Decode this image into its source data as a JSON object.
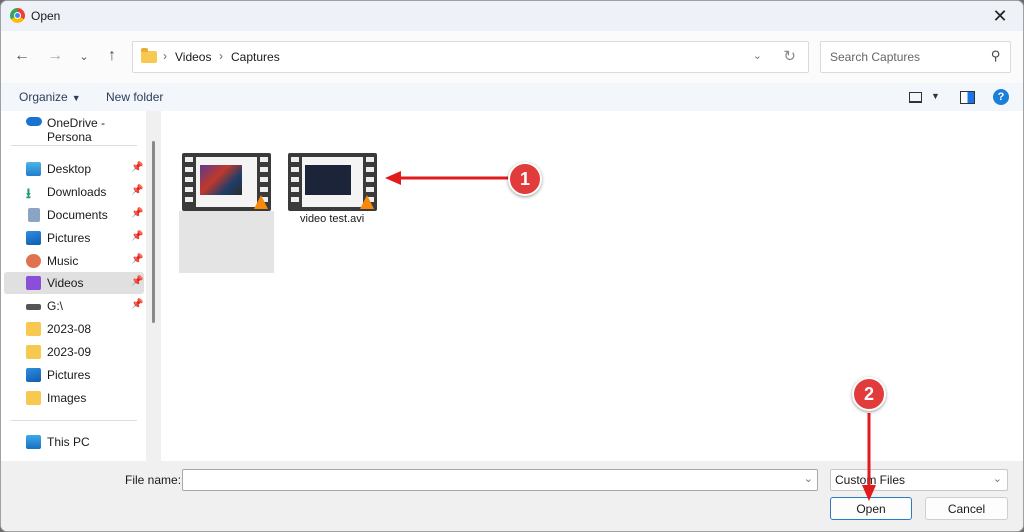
{
  "window": {
    "title": "Open",
    "app_icon": "chrome-icon",
    "close_icon": "close-icon"
  },
  "nav": {
    "back_icon": "arrow-left-icon",
    "forward_icon": "arrow-right-icon",
    "recent_icon": "chevron-down-icon",
    "up_icon": "arrow-up-icon",
    "breadcrumb": [
      "Videos",
      "Captures"
    ],
    "search_placeholder": "Search Captures"
  },
  "toolbar": {
    "organize_label": "Organize",
    "new_folder_label": "New folder"
  },
  "sidebar": {
    "onedrive": {
      "label": "OneDrive - Persona"
    },
    "quick_access": [
      {
        "label": "Desktop",
        "icon": "desktop-icon",
        "pinned": true
      },
      {
        "label": "Downloads",
        "icon": "download-icon",
        "pinned": true
      },
      {
        "label": "Documents",
        "icon": "document-icon",
        "pinned": true
      },
      {
        "label": "Pictures",
        "icon": "pictures-icon",
        "pinned": true
      },
      {
        "label": "Music",
        "icon": "music-icon",
        "pinned": true
      },
      {
        "label": "Videos",
        "icon": "videos-icon",
        "pinned": true,
        "selected": true
      },
      {
        "label": "G:\\",
        "icon": "drive-icon",
        "pinned": true
      },
      {
        "label": "2023-08",
        "icon": "folder-icon",
        "pinned": false
      },
      {
        "label": "2023-09",
        "icon": "folder-icon",
        "pinned": false
      },
      {
        "label": "Pictures",
        "icon": "pictures-icon",
        "pinned": false
      },
      {
        "label": "Images",
        "icon": "folder-icon",
        "pinned": false
      }
    ],
    "this_pc": {
      "label": "This PC"
    }
  },
  "files": [
    {
      "name": "",
      "type": "video-thumbnail"
    },
    {
      "name": "video test.avi",
      "type": "video-thumbnail"
    }
  ],
  "bottom": {
    "file_name_label": "File name:",
    "file_name_value": "",
    "file_type_value": "Custom Files",
    "open_label": "Open",
    "cancel_label": "Cancel"
  },
  "annotations": [
    {
      "number": "1",
      "color": "#e23b3b"
    },
    {
      "number": "2",
      "color": "#e23b3b"
    }
  ]
}
